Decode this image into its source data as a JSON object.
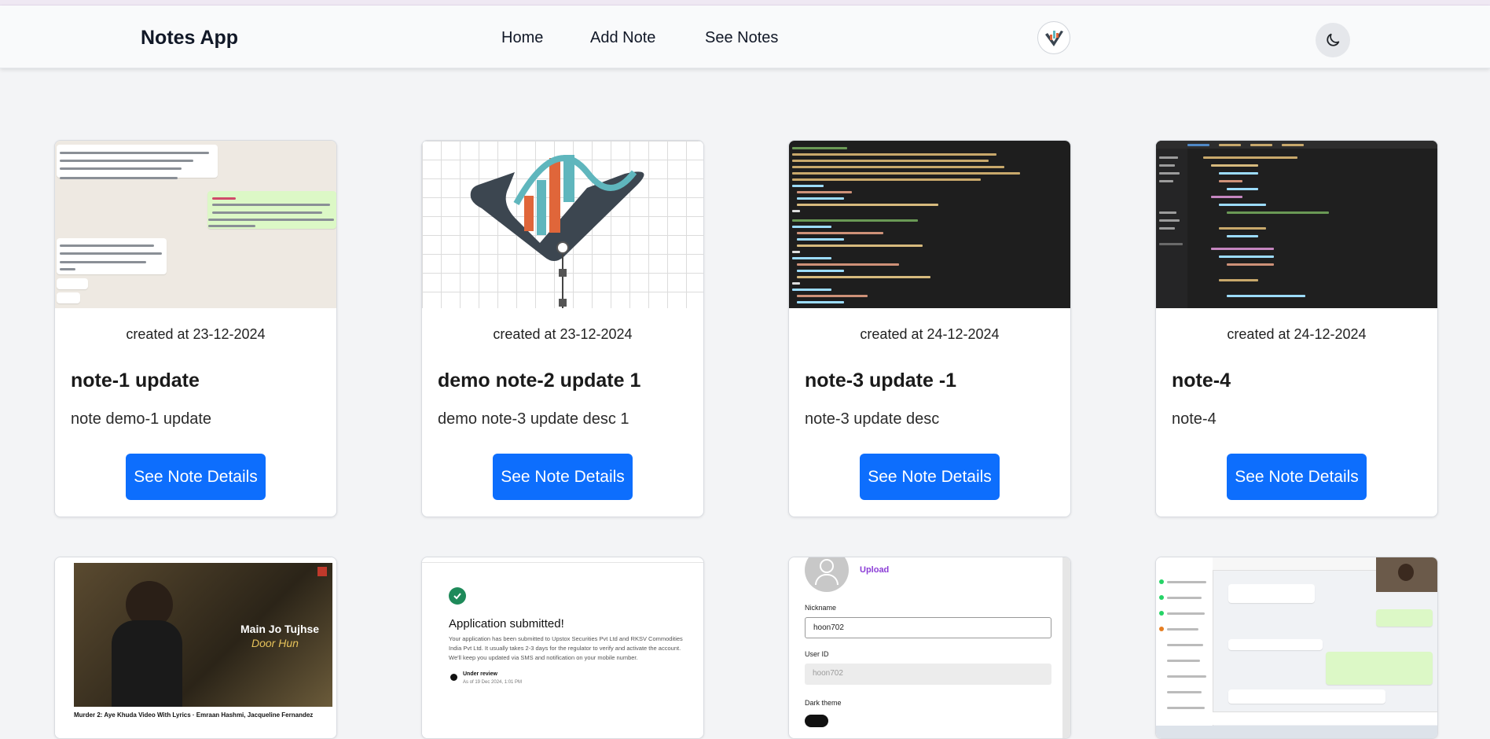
{
  "navbar": {
    "brand": "Notes App",
    "links": [
      "Home",
      "Add Note",
      "See Notes"
    ],
    "logo_icon": "profile-logo-icon",
    "theme_icon": "moon-icon"
  },
  "notes": [
    {
      "created": "created at 23-12-2024",
      "title": "note-1 update",
      "description": "note demo-1 update",
      "button": "See Note Details",
      "image": "chat-screenshot"
    },
    {
      "created": "created at 23-12-2024",
      "title": "demo note-2 update 1",
      "description": "demo note-3 update desc 1",
      "button": "See Note Details",
      "image": "arrow-chart-logo"
    },
    {
      "created": "created at 24-12-2024",
      "title": "note-3 update -1",
      "description": "note-3 update desc",
      "button": "See Note Details",
      "image": "code-screenshot"
    },
    {
      "created": "created at 24-12-2024",
      "title": "note-4",
      "description": "note-4",
      "button": "See Note Details",
      "image": "ide-screenshot"
    }
  ],
  "second_row": {
    "video": {
      "overlay_line1": "Main Jo Tujhse",
      "overlay_line2": "Door Hun",
      "caption": "Murder 2: Aye Khuda Video With Lyrics · Emraan Hashmi, Jacqueline Fernandez"
    },
    "application": {
      "heading": "Application submitted!",
      "body": "Your application has been submitted to Upstox Securities Pvt Ltd and RKSV Commodities India Pvt Ltd. It usually takes 2-3 days for the regulator to verify and activate the account. We'll keep you updated via SMS and notification on your mobile number.",
      "status_title": "Under review",
      "status_sub": "As of 19 Dec 2024, 1:01 PM"
    },
    "profile_form": {
      "upload_label": "Upload",
      "nickname_label": "Nickname",
      "nickname_value": "hoon702",
      "userid_label": "User ID",
      "userid_value": "hoon702",
      "dark_theme_label": "Dark theme"
    }
  },
  "colors": {
    "primary_button": "#0d6efd",
    "page_background": "#f3f4f6",
    "navbar_background": "#f9fafb"
  }
}
